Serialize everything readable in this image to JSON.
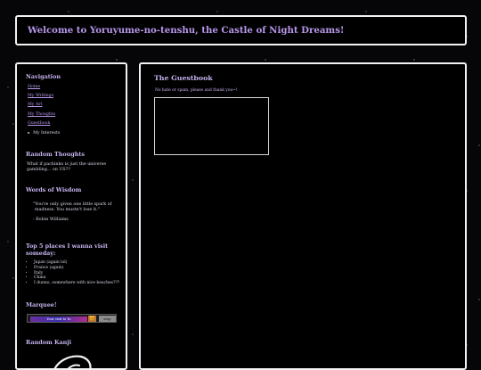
{
  "header": {
    "title": "Welcome to Yoruyume-no-tenshu, the Castle of Night Dreams!"
  },
  "sidebar": {
    "navigation": {
      "heading": "Navigation",
      "items": [
        {
          "label": "Home"
        },
        {
          "label": "My Writings"
        },
        {
          "label": "My Art"
        },
        {
          "label": "My Thoughts"
        },
        {
          "label": "Guestbook"
        },
        {
          "label": "My Interests",
          "current": true,
          "marker": "►"
        }
      ]
    },
    "random_thoughts": {
      "heading": "Random Thoughts",
      "lines": [
        "What if pachinko is just the universe",
        "gambling... on US??"
      ]
    },
    "words_of_wisdom": {
      "heading": "Words of Wisdom",
      "quote_lines": [
        "\"You're only given one little spark of",
        "madness. You mustn't lose it.\""
      ],
      "attribution": "- Robin Williams"
    },
    "top_places": {
      "heading_lines": [
        "Top 5 places I wanna visit",
        "someday:"
      ],
      "items": [
        "Japan (again lol)",
        "France (again)",
        "Italy",
        "China",
        "I dunno, somewhere with nice beaches???"
      ]
    },
    "marquee": {
      "heading": "Marquee!",
      "strip_text": "Your visit to Yo",
      "cat_glyph": "🐱",
      "button_text": "stop"
    },
    "random_kanji": {
      "heading": "Random Kanji"
    }
  },
  "main": {
    "title": "The Guestbook",
    "note": "No hate or spam, please and thank you~!"
  },
  "colors": {
    "accent": "#b796ea",
    "border": "#f2f2f2",
    "panel": "#000000"
  }
}
